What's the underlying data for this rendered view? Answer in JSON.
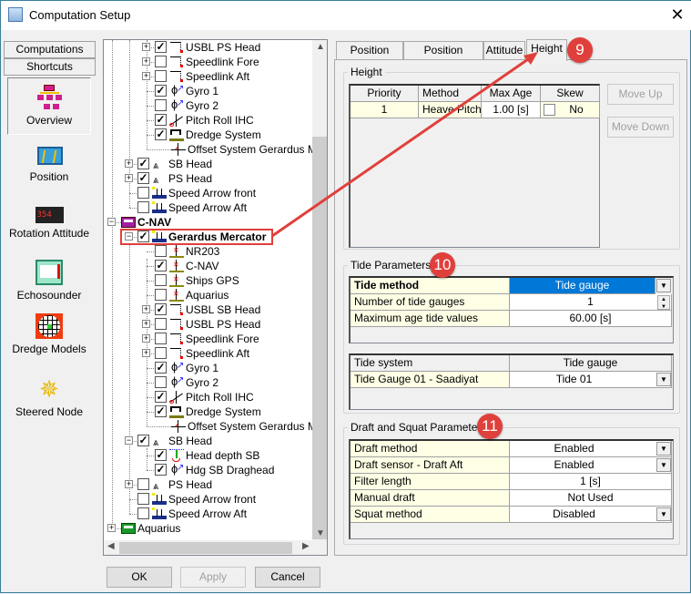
{
  "window": {
    "title": "Computation Setup",
    "close": "✕"
  },
  "sidebar": {
    "tabs": [
      "Computations",
      "Shortcuts"
    ],
    "shortcuts": [
      {
        "label": "Overview",
        "icon": "overview-icon"
      },
      {
        "label": "Position",
        "icon": "position-icon"
      },
      {
        "label": "Rotation Attitude",
        "icon": "rotation-attitude-icon",
        "display": "354"
      },
      {
        "label": "Echosounder",
        "icon": "echosounder-icon"
      },
      {
        "label": "Dredge Models",
        "icon": "dredge-models-icon"
      },
      {
        "label": "Steered Node",
        "icon": "steered-node-icon"
      }
    ]
  },
  "tree": {
    "items": [
      {
        "label": "USBL PS Head",
        "level": 2,
        "exp": "+",
        "check": true,
        "icon": "usbl"
      },
      {
        "label": "Speedlink Fore",
        "level": 2,
        "exp": "+",
        "check": false,
        "icon": "usbl"
      },
      {
        "label": "Speedlink Aft",
        "level": 2,
        "exp": "+",
        "check": false,
        "icon": "usbl"
      },
      {
        "label": "Gyro 1",
        "level": 2,
        "check": true,
        "icon": "gyro"
      },
      {
        "label": "Gyro 2",
        "level": 2,
        "check": false,
        "icon": "gyro"
      },
      {
        "label": "Pitch Roll IHC",
        "level": 2,
        "check": true,
        "icon": "pitch"
      },
      {
        "label": "Dredge System",
        "level": 2,
        "check": true,
        "icon": "dredge"
      },
      {
        "label": "Offset System Gerardus Mercator",
        "level": 2,
        "icon": "offset"
      },
      {
        "label": "SB Head",
        "level": 1,
        "exp": "+",
        "check": true,
        "icon": "head"
      },
      {
        "label": "PS Head",
        "level": 1,
        "exp": "+",
        "check": true,
        "icon": "head"
      },
      {
        "label": "Speed Arrow front",
        "level": 1,
        "check": false,
        "icon": "ship"
      },
      {
        "label": "Speed Arrow Aft",
        "level": 1,
        "check": false,
        "icon": "ship"
      },
      {
        "label": "C-NAV",
        "level": 0,
        "exp": "-",
        "icon": "computer",
        "bold": true
      },
      {
        "label": "Gerardus Mercator",
        "level": 1,
        "exp": "-",
        "check": true,
        "icon": "ship",
        "bold": true,
        "highlight": true
      },
      {
        "label": "NR203",
        "level": 2,
        "check": false,
        "icon": "antenna"
      },
      {
        "label": "C-NAV",
        "level": 2,
        "check": true,
        "icon": "antenna"
      },
      {
        "label": "Ships GPS",
        "level": 2,
        "check": false,
        "icon": "antenna"
      },
      {
        "label": "Aquarius",
        "level": 2,
        "check": false,
        "icon": "antenna"
      },
      {
        "label": "USBL SB Head",
        "level": 2,
        "exp": "+",
        "check": true,
        "icon": "usbl"
      },
      {
        "label": "USBL PS Head",
        "level": 2,
        "exp": "+",
        "check": false,
        "icon": "usbl"
      },
      {
        "label": "Speedlink Fore",
        "level": 2,
        "exp": "+",
        "check": false,
        "icon": "usbl"
      },
      {
        "label": "Speedlink Aft",
        "level": 2,
        "exp": "+",
        "check": false,
        "icon": "usbl"
      },
      {
        "label": "Gyro 1",
        "level": 2,
        "check": true,
        "icon": "gyro"
      },
      {
        "label": "Gyro 2",
        "level": 2,
        "check": false,
        "icon": "gyro"
      },
      {
        "label": "Pitch Roll IHC",
        "level": 2,
        "check": true,
        "icon": "pitch"
      },
      {
        "label": "Dredge System",
        "level": 2,
        "check": true,
        "icon": "dredge"
      },
      {
        "label": "Offset System Gerardus Mercator",
        "level": 2,
        "icon": "offset"
      },
      {
        "label": "SB Head",
        "level": 1,
        "exp": "-",
        "check": true,
        "icon": "head"
      },
      {
        "label": "Head depth SB",
        "level": 2,
        "check": true,
        "icon": "depth"
      },
      {
        "label": "Hdg SB Draghead",
        "level": 2,
        "check": true,
        "icon": "gyro"
      },
      {
        "label": "PS Head",
        "level": 1,
        "exp": "+",
        "check": false,
        "icon": "head"
      },
      {
        "label": "Speed Arrow front",
        "level": 1,
        "check": false,
        "icon": "ship"
      },
      {
        "label": "Speed Arrow Aft",
        "level": 1,
        "check": false,
        "icon": "ship"
      },
      {
        "label": "Aquarius",
        "level": 0,
        "exp": "+",
        "icon": "computer-green"
      }
    ]
  },
  "tabs": [
    {
      "label": "Position Filter"
    },
    {
      "label": "Position Results"
    },
    {
      "label": "Attitude"
    },
    {
      "label": "Height",
      "active": true
    }
  ],
  "height": {
    "title": "Height",
    "columns": [
      "Priority",
      "Method",
      "Max Age",
      "Skew"
    ],
    "rows": [
      {
        "priority": "1",
        "method": "Heave Pitch",
        "max_age": "1.00 [s]",
        "skew": "No",
        "skew_checked": false
      }
    ],
    "move_up": "Move Up",
    "move_down": "Move Down"
  },
  "tide": {
    "title": "Tide Parameters",
    "params": [
      {
        "label": "Tide method",
        "value": "Tide gauge"
      },
      {
        "label": "Number of tide gauges",
        "value": "1"
      },
      {
        "label": "Maximum age tide values",
        "value": "60.00 [s]"
      }
    ],
    "columns": [
      "Tide system",
      "Tide gauge"
    ],
    "rows": [
      {
        "system": "Tide Gauge 01 - Saadiyat",
        "gauge": "Tide 01"
      }
    ]
  },
  "draft": {
    "title": "Draft and Squat Parameters",
    "params": [
      {
        "label": "Draft method",
        "value": "Enabled",
        "dropdown": true
      },
      {
        "label": "Draft sensor - Draft Aft",
        "value": "Enabled",
        "dropdown": true
      },
      {
        "label": "Filter length",
        "value": "1 [s]"
      },
      {
        "label": "Manual draft",
        "value": "Not Used"
      },
      {
        "label": "Squat method",
        "value": "Disabled",
        "dropdown": true
      }
    ]
  },
  "footer": {
    "ok": "OK",
    "apply": "Apply",
    "cancel": "Cancel"
  },
  "annotations": [
    "9",
    "10",
    "11"
  ],
  "colors": {
    "annotation": "#e0403c",
    "selection": "#0078d7",
    "label_bg": "#ffffe6"
  }
}
